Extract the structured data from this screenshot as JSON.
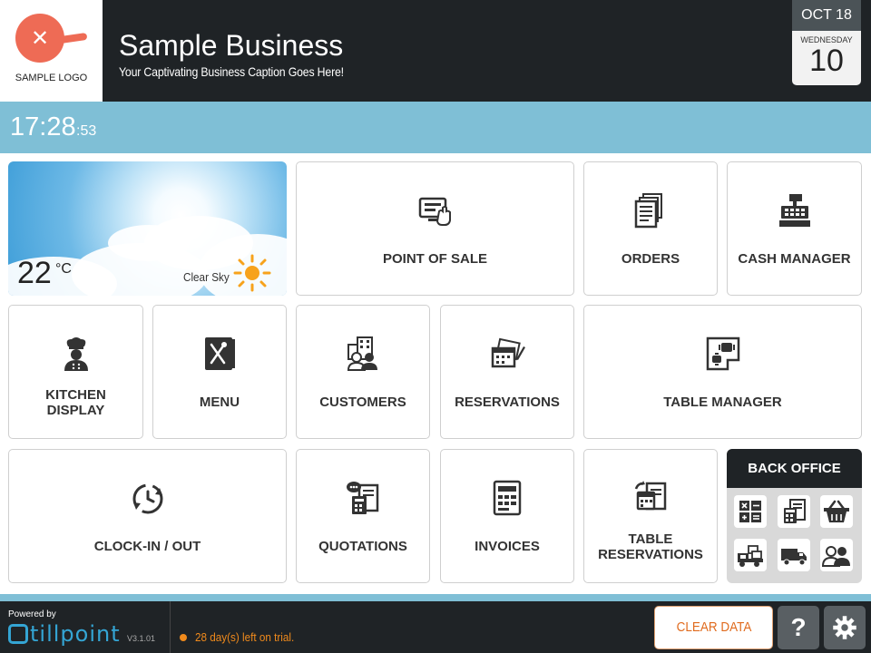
{
  "header": {
    "logo_text": "SAMPLE LOGO",
    "business_name": "Sample Business",
    "caption": "Your Captivating Business Caption Goes Here!",
    "date": {
      "month": "OCT 18",
      "weekday": "WEDNESDAY",
      "day": "10"
    }
  },
  "clock": {
    "time": "17:28",
    "seconds": ":53"
  },
  "weather": {
    "temperature": "22",
    "unit": "°C",
    "description": "Clear Sky",
    "icon": "sun-icon"
  },
  "tiles": [
    {
      "id": "point-of-sale",
      "label": "POINT OF SALE",
      "icon": "pos-touch-icon"
    },
    {
      "id": "orders",
      "label": "ORDERS",
      "icon": "documents-icon"
    },
    {
      "id": "cash-manager",
      "label": "CASH MANAGER",
      "icon": "cash-register-icon"
    },
    {
      "id": "kitchen-display",
      "label": "KITCHEN\nDISPLAY",
      "icon": "chef-icon"
    },
    {
      "id": "menu",
      "label": "MENU",
      "icon": "menu-book-icon"
    },
    {
      "id": "customers",
      "label": "CUSTOMERS",
      "icon": "customers-icon"
    },
    {
      "id": "reservations",
      "label": "RESERVATIONS",
      "icon": "reservations-icon"
    },
    {
      "id": "table-manager",
      "label": "TABLE MANAGER",
      "icon": "floor-plan-icon"
    },
    {
      "id": "clock-in-out",
      "label": "CLOCK-IN / OUT",
      "icon": "clock-cycle-icon"
    },
    {
      "id": "quotations",
      "label": "QUOTATIONS",
      "icon": "quotations-icon"
    },
    {
      "id": "invoices",
      "label": "INVOICES",
      "icon": "invoice-icon"
    },
    {
      "id": "table-reservations",
      "label": "TABLE\nRESERVATIONS",
      "icon": "calendar-refresh-icon"
    }
  ],
  "back_office": {
    "title": "BACK OFFICE",
    "buttons": [
      "calculator-icon",
      "spreadsheet-icon",
      "basket-icon",
      "warehouse-icon",
      "delivery-truck-icon",
      "staff-icon"
    ]
  },
  "footer": {
    "powered_by": "Powered by",
    "brand": "tillpoint",
    "version": "V3.1.01",
    "trial": "28 day(s) left on trial.",
    "clear_data": "CLEAR DATA",
    "help": "?",
    "settings_icon": "gear-icon"
  },
  "colors": {
    "header_bg": "#1f2326",
    "accent_blue": "#7fbfd6",
    "trial_orange": "#f08a1c",
    "logo_red": "#ee6b55"
  }
}
